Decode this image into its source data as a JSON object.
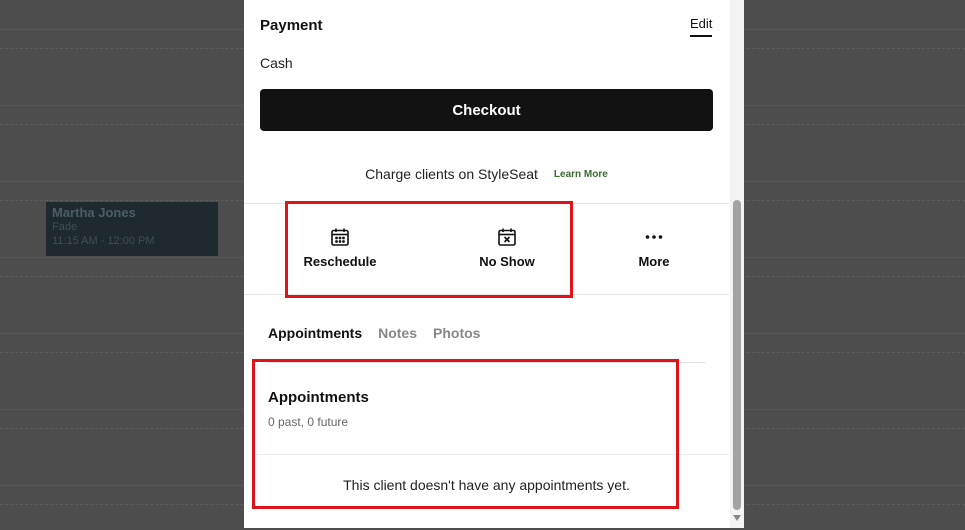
{
  "calendar_event": {
    "client_name": "Martha Jones",
    "service": "Fade",
    "time": "11:15 AM - 12:00 PM"
  },
  "payment": {
    "title": "Payment",
    "edit_label": "Edit",
    "method": "Cash"
  },
  "checkout": {
    "label": "Checkout"
  },
  "charge_promo": {
    "text": "Charge clients on StyleSeat",
    "learn_more": "Learn More"
  },
  "actions": [
    {
      "label": "Reschedule",
      "icon": "calendar-dots-icon"
    },
    {
      "label": "No Show",
      "icon": "calendar-x-icon"
    },
    {
      "label": "More",
      "icon": "more-dots-icon"
    }
  ],
  "tabs": [
    {
      "label": "Appointments",
      "active": true
    },
    {
      "label": "Notes",
      "active": false
    },
    {
      "label": "Photos",
      "active": false
    }
  ],
  "appointments": {
    "title": "Appointments",
    "count_text": "0 past, 0 future",
    "empty_text": "This client doesn't have any appointments yet."
  },
  "colors": {
    "highlight": "#e0121a",
    "checkout_bg": "#121212",
    "learn_more": "#3b6b2f"
  }
}
